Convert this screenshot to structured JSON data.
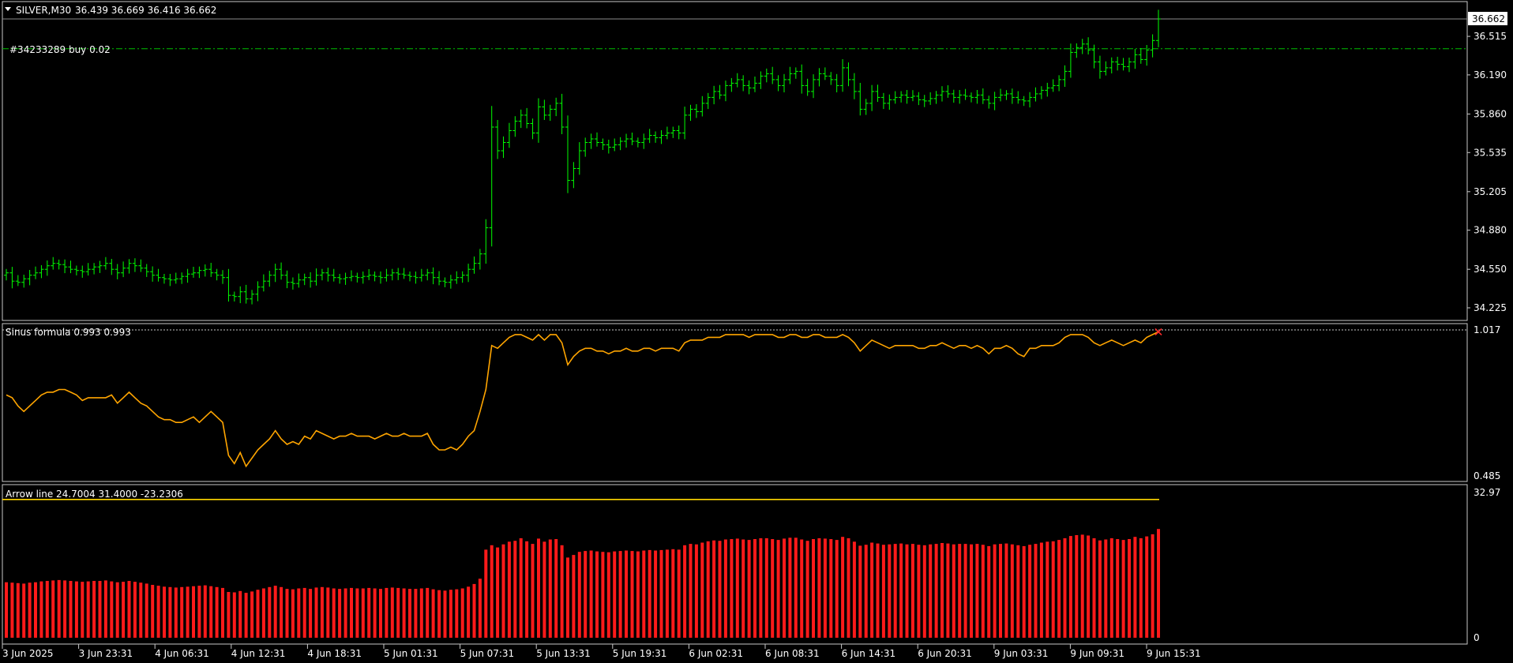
{
  "header": {
    "symbol": "SILVER,M30",
    "ohlc": "36.439 36.669 36.416 36.662",
    "order_label": "#34233289 buy 0.02"
  },
  "indicators": {
    "sinus_label": "Sinus formula 0.993 0.993",
    "arrow_label": "Arrow line 24.7004 31.4000 -23.2306"
  },
  "colors": {
    "background": "#000000",
    "candle": "#00ff00",
    "order_line": "#00c000",
    "sinus_line": "#ffa500",
    "arrow_line": "#ffd700",
    "histogram": "#ff1a1a",
    "frame": "#c8c8c8"
  },
  "chart_data": [
    {
      "type": "candlestick",
      "title": "SILVER,M30",
      "ylim": [
        34.08,
        36.73
      ],
      "y_ticks": [
        "36.515",
        "36.190",
        "35.860",
        "35.535",
        "35.205",
        "34.880",
        "34.550",
        "34.225"
      ],
      "current_price": "36.662",
      "order_price": 36.41,
      "close": [
        34.52,
        34.45,
        34.44,
        34.47,
        34.5,
        34.52,
        34.55,
        34.58,
        34.6,
        34.59,
        34.57,
        34.55,
        34.54,
        34.53,
        34.55,
        34.57,
        34.58,
        34.6,
        34.55,
        34.52,
        34.56,
        34.6,
        34.58,
        34.56,
        34.53,
        34.5,
        34.48,
        34.47,
        34.46,
        34.47,
        34.49,
        34.51,
        34.52,
        34.54,
        34.55,
        34.52,
        34.5,
        34.48,
        34.33,
        34.32,
        34.36,
        34.3,
        34.34,
        34.4,
        34.45,
        34.5,
        34.55,
        34.5,
        34.44,
        34.43,
        34.46,
        34.48,
        34.45,
        34.5,
        34.52,
        34.5,
        34.48,
        34.47,
        34.48,
        34.49,
        34.48,
        34.49,
        34.5,
        34.49,
        34.48,
        34.5,
        34.52,
        34.51,
        34.5,
        34.49,
        34.48,
        34.5,
        34.52,
        34.48,
        34.45,
        34.44,
        34.46,
        34.48,
        34.5,
        34.55,
        34.6,
        34.68,
        34.9,
        35.75,
        35.55,
        35.62,
        35.72,
        35.8,
        35.85,
        35.78,
        35.7,
        35.92,
        35.85,
        35.9,
        35.95,
        35.75,
        35.3,
        35.4,
        35.55,
        35.62,
        35.65,
        35.62,
        35.6,
        35.58,
        35.6,
        35.63,
        35.65,
        35.63,
        35.62,
        35.65,
        35.68,
        35.66,
        35.68,
        35.7,
        35.72,
        35.7,
        35.85,
        35.9,
        35.88,
        35.95,
        36.0,
        36.05,
        36.02,
        36.1,
        36.12,
        36.15,
        36.1,
        36.08,
        36.12,
        36.18,
        36.2,
        36.15,
        36.1,
        36.15,
        36.2,
        36.22,
        36.1,
        36.05,
        36.15,
        36.2,
        36.18,
        36.15,
        36.1,
        36.25,
        36.15,
        36.05,
        35.9,
        35.95,
        36.05,
        36.0,
        35.95,
        35.98,
        36.0,
        36.02,
        36.0,
        36.01,
        35.98,
        35.97,
        35.99,
        36.02,
        36.05,
        36.03,
        36.0,
        36.02,
        36.01,
        36.0,
        36.02,
        35.98,
        35.95,
        36.0,
        36.02,
        36.03,
        36.0,
        35.98,
        35.97,
        36.0,
        36.03,
        36.06,
        36.08,
        36.1,
        36.15,
        36.22,
        36.38,
        36.42,
        36.45,
        36.4,
        36.3,
        36.22,
        36.25,
        36.3,
        36.28,
        36.26,
        36.3,
        36.36,
        36.32,
        36.4,
        36.48,
        36.662
      ]
    },
    {
      "type": "line",
      "title": "Sinus formula 0.993 0.993",
      "ylim": [
        0.485,
        1.017
      ],
      "y_ticks": [
        "1.017",
        "0.485"
      ],
      "values": [
        0.78,
        0.77,
        0.74,
        0.72,
        0.74,
        0.76,
        0.78,
        0.79,
        0.79,
        0.8,
        0.8,
        0.79,
        0.78,
        0.76,
        0.77,
        0.77,
        0.77,
        0.77,
        0.78,
        0.75,
        0.77,
        0.79,
        0.77,
        0.75,
        0.74,
        0.72,
        0.7,
        0.69,
        0.69,
        0.68,
        0.68,
        0.69,
        0.7,
        0.68,
        0.7,
        0.72,
        0.7,
        0.68,
        0.56,
        0.53,
        0.57,
        0.52,
        0.55,
        0.58,
        0.6,
        0.62,
        0.65,
        0.62,
        0.6,
        0.61,
        0.6,
        0.63,
        0.62,
        0.65,
        0.64,
        0.63,
        0.62,
        0.63,
        0.63,
        0.64,
        0.63,
        0.63,
        0.63,
        0.62,
        0.63,
        0.64,
        0.63,
        0.63,
        0.64,
        0.63,
        0.63,
        0.63,
        0.64,
        0.6,
        0.58,
        0.58,
        0.59,
        0.58,
        0.6,
        0.63,
        0.65,
        0.72,
        0.8,
        0.96,
        0.95,
        0.97,
        0.99,
        1.0,
        1.0,
        0.99,
        0.98,
        1.0,
        0.98,
        1.0,
        1.0,
        0.97,
        0.89,
        0.92,
        0.94,
        0.95,
        0.95,
        0.94,
        0.94,
        0.93,
        0.94,
        0.94,
        0.95,
        0.94,
        0.94,
        0.95,
        0.95,
        0.94,
        0.95,
        0.95,
        0.95,
        0.94,
        0.97,
        0.98,
        0.98,
        0.98,
        0.99,
        0.99,
        0.99,
        1.0,
        1.0,
        1.0,
        1.0,
        0.99,
        1.0,
        1.0,
        1.0,
        1.0,
        0.99,
        0.99,
        1.0,
        1.0,
        0.99,
        0.99,
        1.0,
        1.0,
        0.99,
        0.99,
        0.99,
        1.0,
        0.99,
        0.97,
        0.94,
        0.96,
        0.98,
        0.97,
        0.96,
        0.95,
        0.96,
        0.96,
        0.96,
        0.96,
        0.95,
        0.95,
        0.96,
        0.96,
        0.97,
        0.96,
        0.95,
        0.96,
        0.96,
        0.95,
        0.96,
        0.95,
        0.93,
        0.95,
        0.95,
        0.96,
        0.95,
        0.93,
        0.92,
        0.95,
        0.95,
        0.96,
        0.96,
        0.96,
        0.97,
        0.99,
        1.0,
        1.0,
        1.0,
        0.99,
        0.97,
        0.96,
        0.97,
        0.98,
        0.97,
        0.96,
        0.97,
        0.98,
        0.97,
        0.99,
        1.0,
        1.01
      ]
    },
    {
      "type": "bar",
      "title": "Arrow line 24.7004 31.4000 -23.2306",
      "ylim": [
        0,
        32.97
      ],
      "y_ticks": [
        "32.97",
        "0"
      ],
      "arrow_line_value": 31.4,
      "values": [
        12.6,
        12.5,
        12.4,
        12.3,
        12.5,
        12.6,
        12.8,
        12.9,
        13.0,
        13.1,
        13.0,
        12.9,
        12.8,
        12.7,
        12.8,
        12.9,
        12.9,
        13.0,
        12.8,
        12.6,
        12.7,
        12.9,
        12.7,
        12.5,
        12.3,
        12.0,
        11.8,
        11.6,
        11.5,
        11.4,
        11.5,
        11.6,
        11.7,
        11.8,
        11.9,
        11.7,
        11.5,
        11.3,
        10.4,
        10.3,
        10.6,
        10.2,
        10.5,
        10.9,
        11.2,
        11.5,
        11.8,
        11.5,
        11.1,
        11.0,
        11.2,
        11.3,
        11.1,
        11.4,
        11.5,
        11.4,
        11.2,
        11.1,
        11.2,
        11.3,
        11.2,
        11.2,
        11.3,
        11.2,
        11.1,
        11.3,
        11.4,
        11.3,
        11.2,
        11.1,
        11.1,
        11.2,
        11.3,
        11.0,
        10.8,
        10.7,
        10.9,
        11.0,
        11.2,
        11.6,
        12.2,
        13.4,
        20.0,
        21.0,
        20.5,
        21.2,
        21.8,
        22.0,
        22.6,
        21.9,
        21.3,
        22.5,
        21.8,
        22.3,
        22.4,
        21.0,
        18.2,
        18.8,
        19.5,
        19.7,
        19.8,
        19.6,
        19.5,
        19.4,
        19.6,
        19.7,
        19.8,
        19.7,
        19.6,
        19.8,
        19.9,
        19.8,
        19.9,
        20.0,
        20.1,
        20.0,
        21.0,
        21.3,
        21.2,
        21.6,
        21.9,
        22.1,
        22.0,
        22.3,
        22.4,
        22.5,
        22.3,
        22.2,
        22.4,
        22.6,
        22.6,
        22.4,
        22.2,
        22.5,
        22.7,
        22.7,
        22.3,
        22.0,
        22.4,
        22.6,
        22.5,
        22.4,
        22.2,
        22.9,
        22.6,
        21.8,
        20.9,
        21.1,
        21.6,
        21.4,
        21.1,
        21.2,
        21.3,
        21.4,
        21.2,
        21.3,
        21.1,
        21.0,
        21.2,
        21.3,
        21.5,
        21.4,
        21.2,
        21.3,
        21.3,
        21.2,
        21.3,
        21.1,
        20.8,
        21.2,
        21.3,
        21.4,
        21.2,
        21.0,
        20.8,
        21.1,
        21.3,
        21.6,
        21.8,
        21.9,
        22.2,
        22.6,
        23.1,
        23.3,
        23.4,
        23.2,
        22.6,
        22.1,
        22.3,
        22.6,
        22.4,
        22.2,
        22.4,
        22.9,
        22.6,
        23.0,
        23.5,
        24.7
      ]
    }
  ],
  "x_axis": {
    "ticks": [
      "3 Jun 2025",
      "3 Jun 23:31",
      "4 Jun 06:31",
      "4 Jun 12:31",
      "4 Jun 18:31",
      "5 Jun 01:31",
      "5 Jun 07:31",
      "5 Jun 13:31",
      "5 Jun 19:31",
      "6 Jun 02:31",
      "6 Jun 08:31",
      "6 Jun 14:31",
      "6 Jun 20:31",
      "9 Jun 03:31",
      "9 Jun 09:31",
      "9 Jun 15:31"
    ]
  }
}
